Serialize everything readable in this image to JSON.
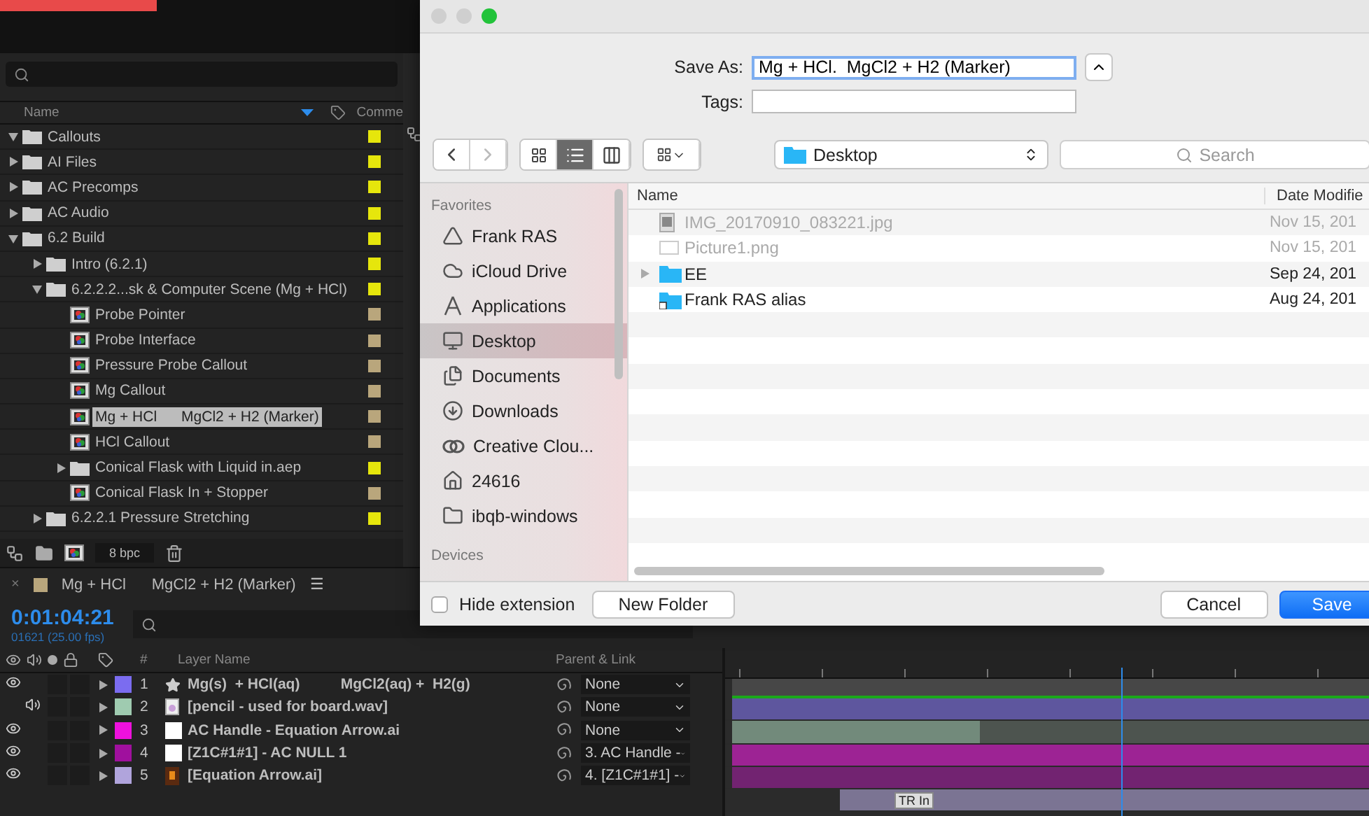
{
  "project": {
    "columns": [
      "Name",
      "Comme"
    ],
    "items": [
      {
        "name": "Callouts",
        "kind": "folder",
        "expanded": true,
        "selected": false,
        "color": "#e6e60c"
      },
      {
        "name": "AI Files",
        "kind": "folder",
        "expanded": false,
        "selected": false,
        "color": "#e6e60c"
      },
      {
        "name": "AC Precomps",
        "kind": "folder",
        "expanded": false,
        "selected": false,
        "color": "#e6e60c"
      },
      {
        "name": "AC Audio",
        "kind": "folder",
        "expanded": false,
        "selected": false,
        "color": "#e6e60c"
      },
      {
        "name": "6.2 Build",
        "kind": "folder",
        "expanded": true,
        "selected": false,
        "color": "#e6e60c",
        "children": [
          {
            "name": "Intro (6.2.1)",
            "kind": "folder",
            "expanded": false,
            "selected": false,
            "color": "#e6e60c"
          },
          {
            "name": "6.2.2.2...sk & Computer Scene (Mg + HCl)",
            "kind": "folder",
            "expanded": true,
            "selected": false,
            "color": "#e6e60c",
            "children": [
              {
                "name": "Probe Pointer",
                "kind": "comp",
                "selected": false,
                "color": "#b9a67c"
              },
              {
                "name": "Probe Interface",
                "kind": "comp",
                "selected": false,
                "color": "#b9a67c"
              },
              {
                "name": "Pressure Probe Callout",
                "kind": "comp",
                "selected": false,
                "color": "#b9a67c"
              },
              {
                "name": "Mg Callout",
                "kind": "comp",
                "selected": false,
                "color": "#b9a67c"
              },
              {
                "name": "Mg + HCl      MgCl2 + H2 (Marker)",
                "kind": "comp",
                "selected": true,
                "color": "#b9a67c"
              },
              {
                "name": "HCl Callout",
                "kind": "comp",
                "selected": false,
                "color": "#b9a67c"
              },
              {
                "name": "Conical Flask with Liquid in.aep",
                "kind": "folder",
                "expanded": false,
                "selected": false,
                "color": "#e6e60c"
              },
              {
                "name": "Conical Flask In + Stopper",
                "kind": "comp",
                "selected": false,
                "color": "#b9a67c"
              }
            ]
          },
          {
            "name": "6.2.2.1 Pressure Stretching",
            "kind": "folder",
            "expanded": false,
            "selected": false,
            "color": "#e6e60c"
          }
        ]
      }
    ],
    "bpc": "8 bpc"
  },
  "timeline": {
    "tab": {
      "title": "Mg + HCl      MgCl2 + H2 (Marker)",
      "color": "#b9a67c",
      "menu": "☰",
      "close": "×"
    },
    "timecode": "0:01:04:21",
    "frames": "01621 (25.00 fps)",
    "columns": [
      "#",
      "Layer Name",
      "Parent & Link"
    ],
    "layers": [
      {
        "number": "1",
        "name": "Mg(s)  + HCl(aq)          MgCl2(aq) +  H2(g)",
        "kind": "shape",
        "visible": true,
        "audio": false,
        "color": "#7b6cf0",
        "parent": "None"
      },
      {
        "number": "2",
        "name": "[pencil - used for board.wav]",
        "kind": "audio",
        "visible": false,
        "audio": true,
        "color": "#9fcbb0",
        "parent": "None"
      },
      {
        "number": "3",
        "name": "AC Handle - Equation Arrow.ai",
        "kind": "solid",
        "visible": true,
        "audio": false,
        "color": "#ee11dd",
        "parent": "None"
      },
      {
        "number": "4",
        "name": "[Z1C#1#1] - AC NULL 1",
        "kind": "solid",
        "visible": true,
        "audio": false,
        "color": "#a0109e",
        "parent": "3. AC Handle -"
      },
      {
        "number": "5",
        "name": "[Equation Arrow.ai]",
        "kind": "vector",
        "visible": true,
        "audio": false,
        "color": "#b0a4dc",
        "parent": "4. [Z1C#1#1] -",
        "marker": "TR In"
      }
    ]
  },
  "dialog": {
    "save_as": {
      "label": "Save As:",
      "value": "Mg + HCl.  MgCl2 + H2 (Marker)"
    },
    "tags": {
      "label": "Tags:"
    },
    "back_disabled": false,
    "forward_disabled": true,
    "views": [
      {
        "kind": "icons",
        "selected": false
      },
      {
        "kind": "list",
        "selected": true
      },
      {
        "kind": "columns",
        "selected": false
      }
    ],
    "location": "Desktop",
    "search": {
      "placeholder": "Search"
    },
    "sidebar": [
      {
        "title": "Favorites",
        "items": [
          {
            "label": "Frank RAS",
            "kind": "drive",
            "selected": false
          },
          {
            "label": "iCloud Drive",
            "kind": "cloud",
            "selected": false
          },
          {
            "label": "Applications",
            "kind": "apps",
            "selected": false
          },
          {
            "label": "Desktop",
            "kind": "desktop",
            "selected": true
          },
          {
            "label": "Documents",
            "kind": "documents",
            "selected": false
          },
          {
            "label": "Downloads",
            "kind": "downloads",
            "selected": false
          },
          {
            "label": "Creative Clou...",
            "kind": "creative",
            "selected": false
          },
          {
            "label": "24616",
            "kind": "home",
            "selected": false
          },
          {
            "label": "ibqb-windows",
            "kind": "folder",
            "selected": false
          }
        ]
      },
      {
        "title": "Devices"
      }
    ],
    "columns": [
      "Name",
      "Date Modifie"
    ],
    "files": [
      {
        "name": "IMG_20170910_083221.jpg",
        "date": "Nov 15, 201",
        "kind": "image",
        "disabled": true,
        "expandable": false
      },
      {
        "name": "Picture1.png",
        "date": "Nov 15, 201",
        "kind": "png",
        "disabled": true,
        "expandable": false
      },
      {
        "name": "EE",
        "date": "Sep 24, 201",
        "kind": "folder",
        "disabled": false,
        "expandable": true
      },
      {
        "name": "Frank RAS alias",
        "date": "Aug 24, 201",
        "kind": "alias",
        "disabled": false,
        "expandable": false
      }
    ],
    "hide_extension": {
      "label": "Hide extension",
      "checked": false
    },
    "buttons": [
      {
        "label": "New Folder",
        "kind": "normal"
      },
      {
        "label": "Cancel",
        "kind": "normal"
      },
      {
        "label": "Save",
        "kind": "default"
      }
    ]
  }
}
